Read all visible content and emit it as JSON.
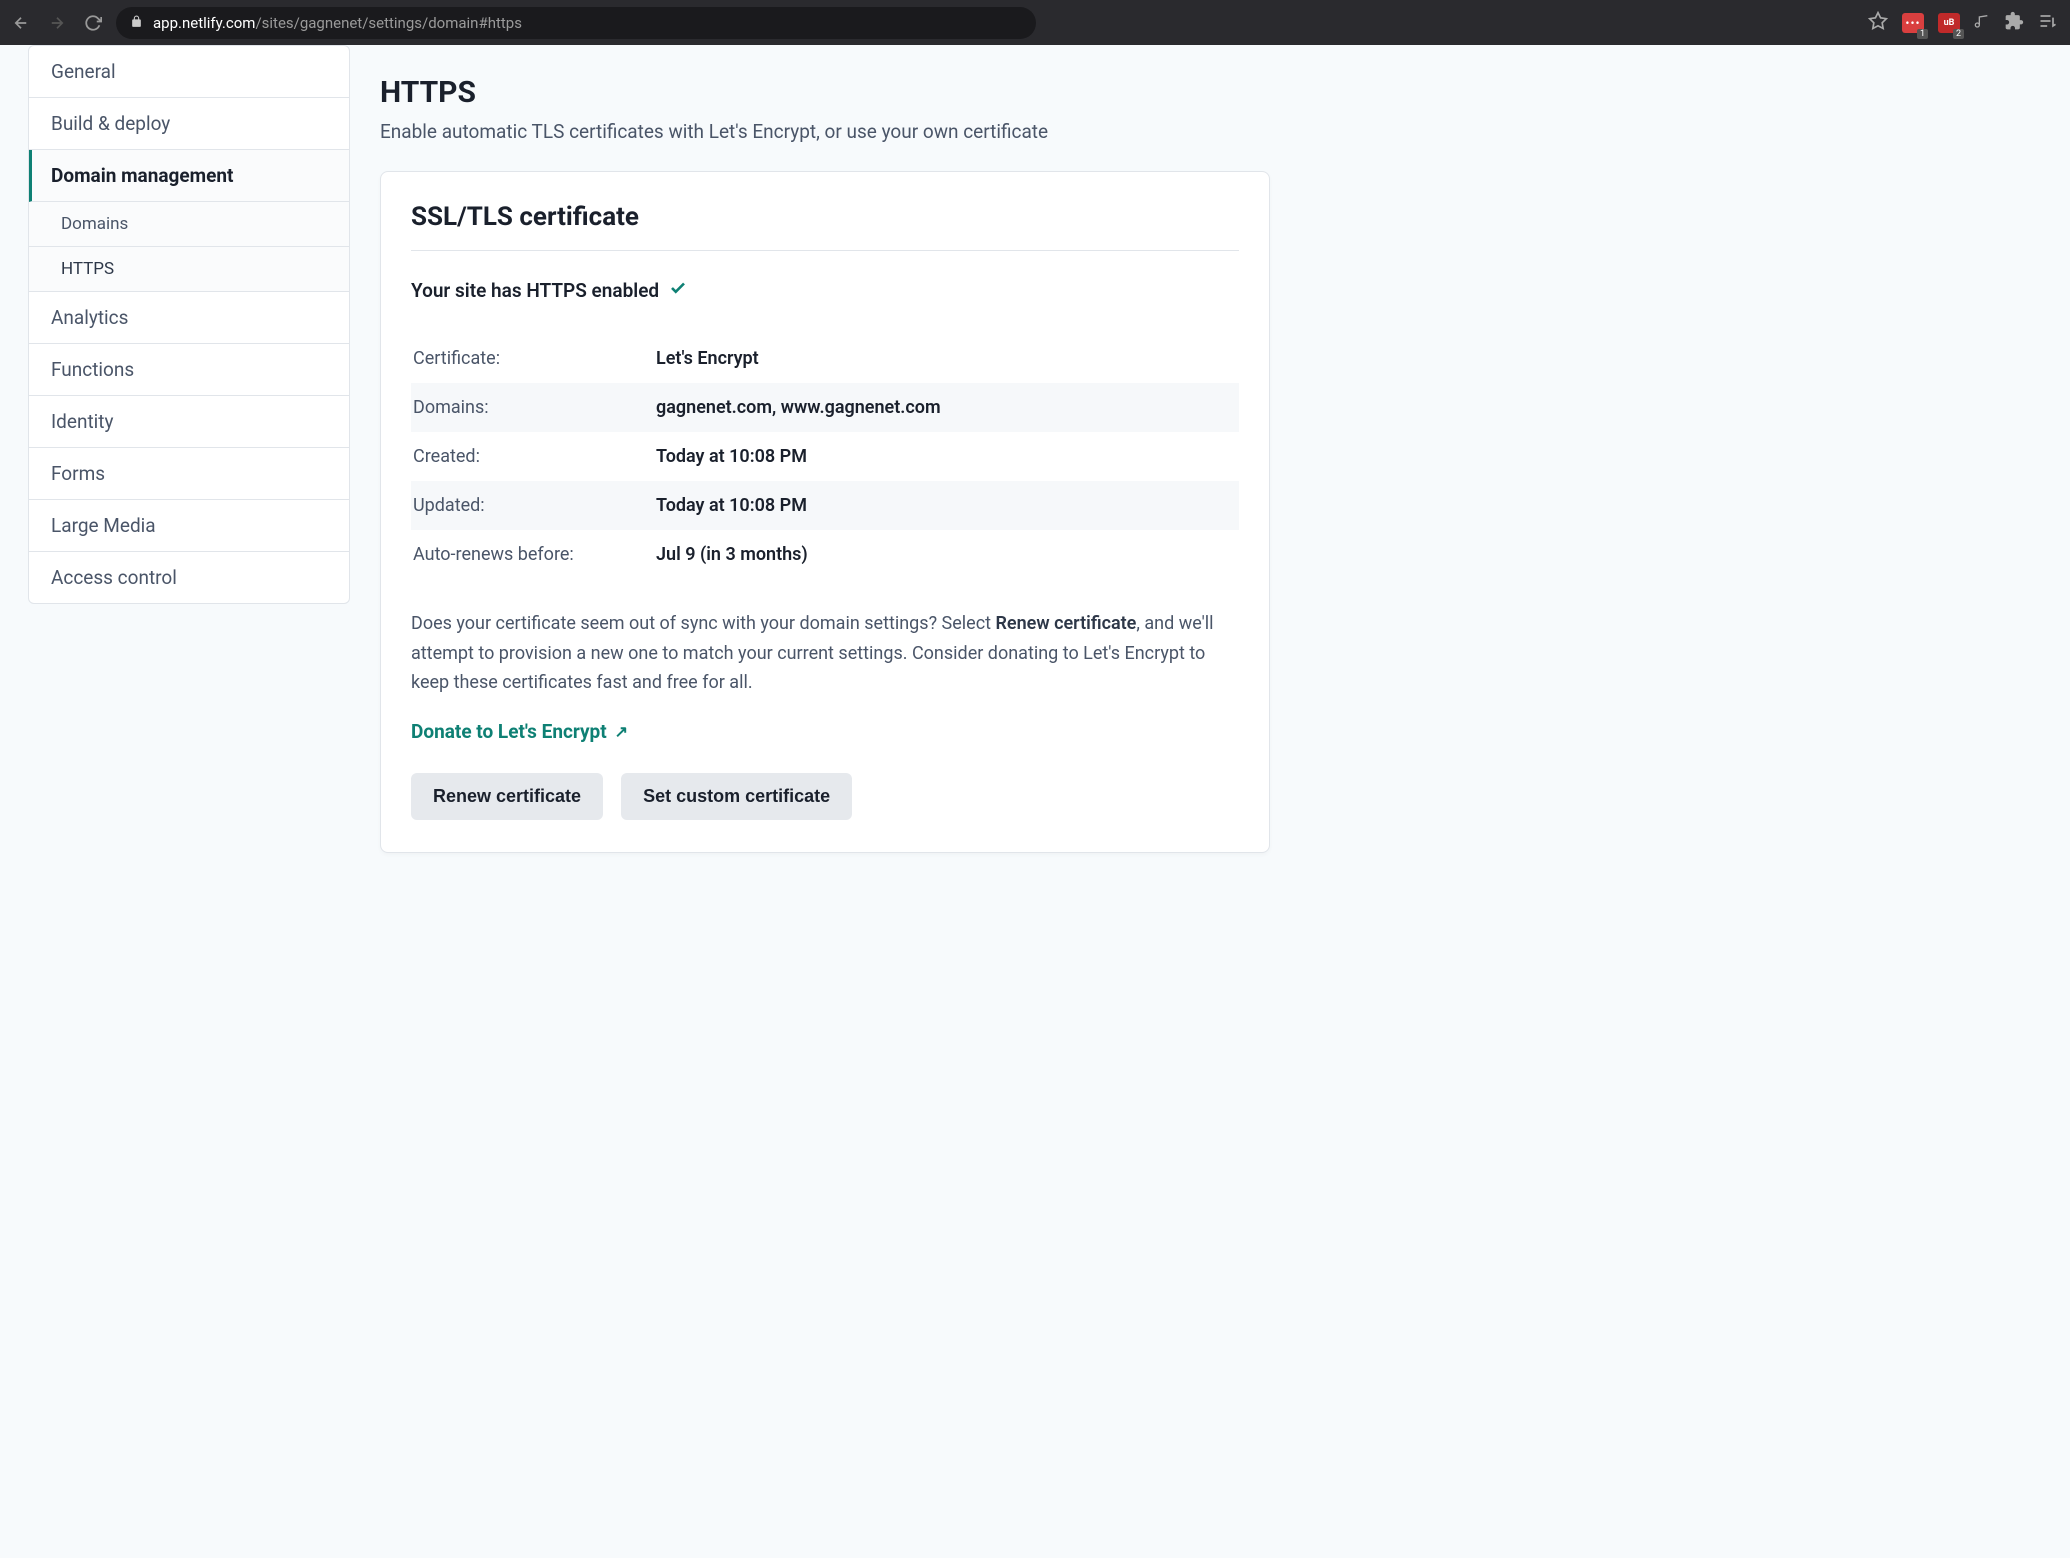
{
  "browser": {
    "url_host": "app.netlify.com",
    "url_path": "/sites/gagnenet/settings/domain#https",
    "ext1_count": "1",
    "ext2_count": "2"
  },
  "sidebar": {
    "items": [
      {
        "label": "General"
      },
      {
        "label": "Build & deploy"
      },
      {
        "label": "Domain management"
      },
      {
        "label": "Analytics"
      },
      {
        "label": "Functions"
      },
      {
        "label": "Identity"
      },
      {
        "label": "Forms"
      },
      {
        "label": "Large Media"
      },
      {
        "label": "Access control"
      }
    ],
    "subitems": [
      {
        "label": "Domains"
      },
      {
        "label": "HTTPS"
      }
    ]
  },
  "page": {
    "title": "HTTPS",
    "subtitle": "Enable automatic TLS certificates with Let's Encrypt, or use your own certificate"
  },
  "card": {
    "title": "SSL/TLS certificate",
    "status": "Your site has HTTPS enabled",
    "rows": [
      {
        "label": "Certificate:",
        "value": "Let's Encrypt"
      },
      {
        "label": "Domains:",
        "value": "gagnenet.com, www.gagnenet.com"
      },
      {
        "label": "Created:",
        "value": "Today at 10:08 PM"
      },
      {
        "label": "Updated:",
        "value": "Today at 10:08 PM"
      },
      {
        "label": "Auto-renews before:",
        "value": "Jul 9 (in 3 months)"
      }
    ],
    "help_pre": "Does your certificate seem out of sync with your domain settings? Select ",
    "help_bold": "Renew certificate",
    "help_post": ", and we'll attempt to provision a new one to match your current settings. Consider donating to Let's Encrypt to keep these certificates fast and free for all.",
    "donate_label": "Donate to Let's Encrypt",
    "renew_button": "Renew certificate",
    "custom_button": "Set custom certificate"
  }
}
